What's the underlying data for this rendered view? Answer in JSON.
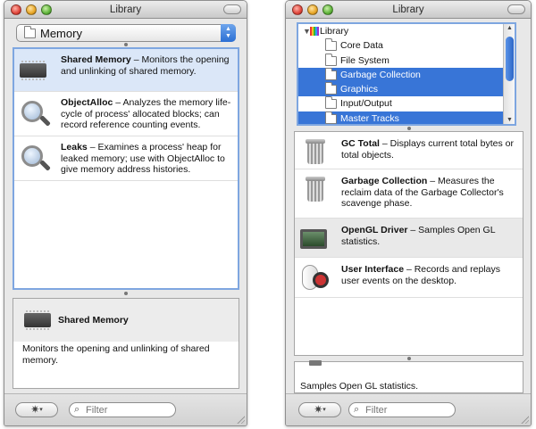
{
  "left": {
    "title": "Library",
    "popup_value": "Memory",
    "instruments": [
      {
        "name": "Shared Memory",
        "desc": " – Monitors the opening and unlinking of shared memory.",
        "icon": "memory-chip-icon"
      },
      {
        "name": "ObjectAlloc",
        "desc": " – Analyzes the memory life-cycle of process' allocated blocks; can record reference counting events.",
        "icon": "magnifier-icon"
      },
      {
        "name": "Leaks",
        "desc": " – Examines a process' heap for leaked memory; use with ObjectAlloc to give memory address histories.",
        "icon": "magnifier-icon"
      }
    ],
    "detail": {
      "title": "Shared Memory",
      "desc": "Monitors the opening and unlinking of shared memory."
    },
    "filter_placeholder": "Filter"
  },
  "right": {
    "title": "Library",
    "tree": {
      "root": "Library",
      "children": [
        {
          "label": "Core Data",
          "selected": false
        },
        {
          "label": "File System",
          "selected": false
        },
        {
          "label": "Garbage Collection",
          "selected": true
        },
        {
          "label": "Graphics",
          "selected": true
        },
        {
          "label": "Input/Output",
          "selected": false
        },
        {
          "label": "Master Tracks",
          "selected": true
        }
      ]
    },
    "instruments": [
      {
        "name": "GC Total",
        "desc": " – Displays current total bytes or total objects.",
        "icon": "trash-can-icon"
      },
      {
        "name": "Garbage Collection",
        "desc": " – Measures the reclaim data of the Garbage Collector's scavenge phase.",
        "icon": "trash-can-icon"
      },
      {
        "name": "OpenGL Driver",
        "desc": " – Samples Open GL statistics.",
        "icon": "monitor-icon"
      },
      {
        "name": "User Interface",
        "desc": " – Records and replays user events on the desktop.",
        "icon": "mouse-wheel-icon"
      }
    ],
    "detail": {
      "desc": "Samples Open GL statistics."
    },
    "filter_placeholder": "Filter"
  },
  "colors": {
    "selection": "#3875d7",
    "focus_ring": "#7ea6e0",
    "row_highlight": "#dbe7f8"
  }
}
